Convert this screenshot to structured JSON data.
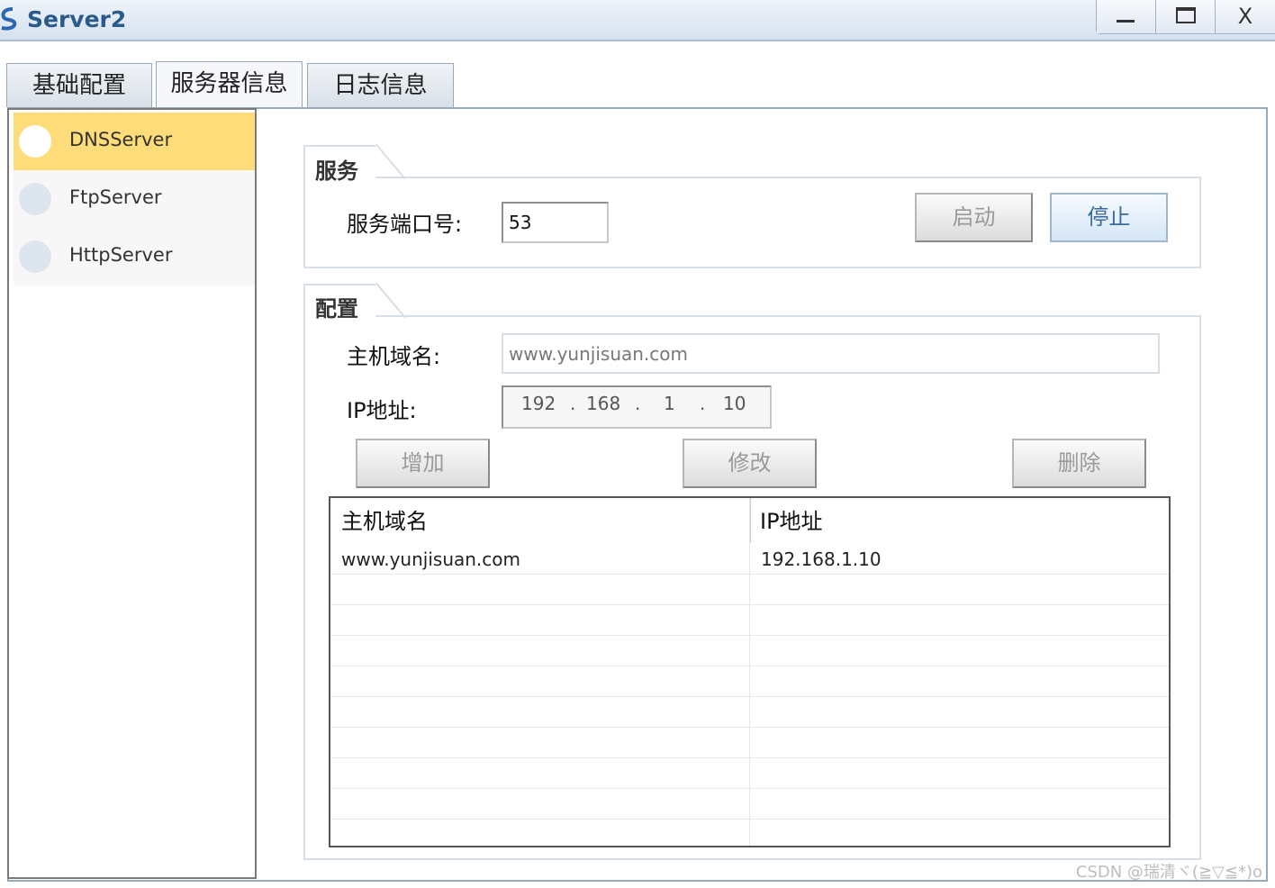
{
  "window": {
    "title": "Server2",
    "controls": {
      "minimize": "minimize-icon",
      "maximize": "maximize-icon",
      "close": "X"
    }
  },
  "tabs": [
    {
      "label": "基础配置",
      "active": false
    },
    {
      "label": "服务器信息",
      "active": true
    },
    {
      "label": "日志信息",
      "active": false
    }
  ],
  "sidebar": {
    "items": [
      {
        "label": "DNSServer",
        "active": true
      },
      {
        "label": "FtpServer",
        "active": false
      },
      {
        "label": "HttpServer",
        "active": false
      }
    ]
  },
  "service": {
    "title": "服务",
    "port_label": "服务端口号:",
    "port_value": "53",
    "start_label": "启动",
    "stop_label": "停止"
  },
  "config": {
    "title": "配置",
    "domain_label": "主机域名:",
    "domain_value": "www.yunjisuan.com",
    "ip_label": "IP地址:",
    "ip_parts": [
      "192",
      "168",
      "1",
      "10"
    ],
    "ip_separator": ".",
    "add_label": "增加",
    "modify_label": "修改",
    "delete_label": "删除"
  },
  "table": {
    "headers": [
      "主机域名",
      "IP地址"
    ],
    "rows": [
      [
        "www.yunjisuan.com",
        "192.168.1.10"
      ]
    ]
  },
  "watermark": "CSDN @瑞清ヾ(≧▽≦*)o",
  "colors": {
    "accent": "#ffdc7a",
    "title": "#2a5a8c",
    "primary_button_text": "#3a6a9e"
  }
}
